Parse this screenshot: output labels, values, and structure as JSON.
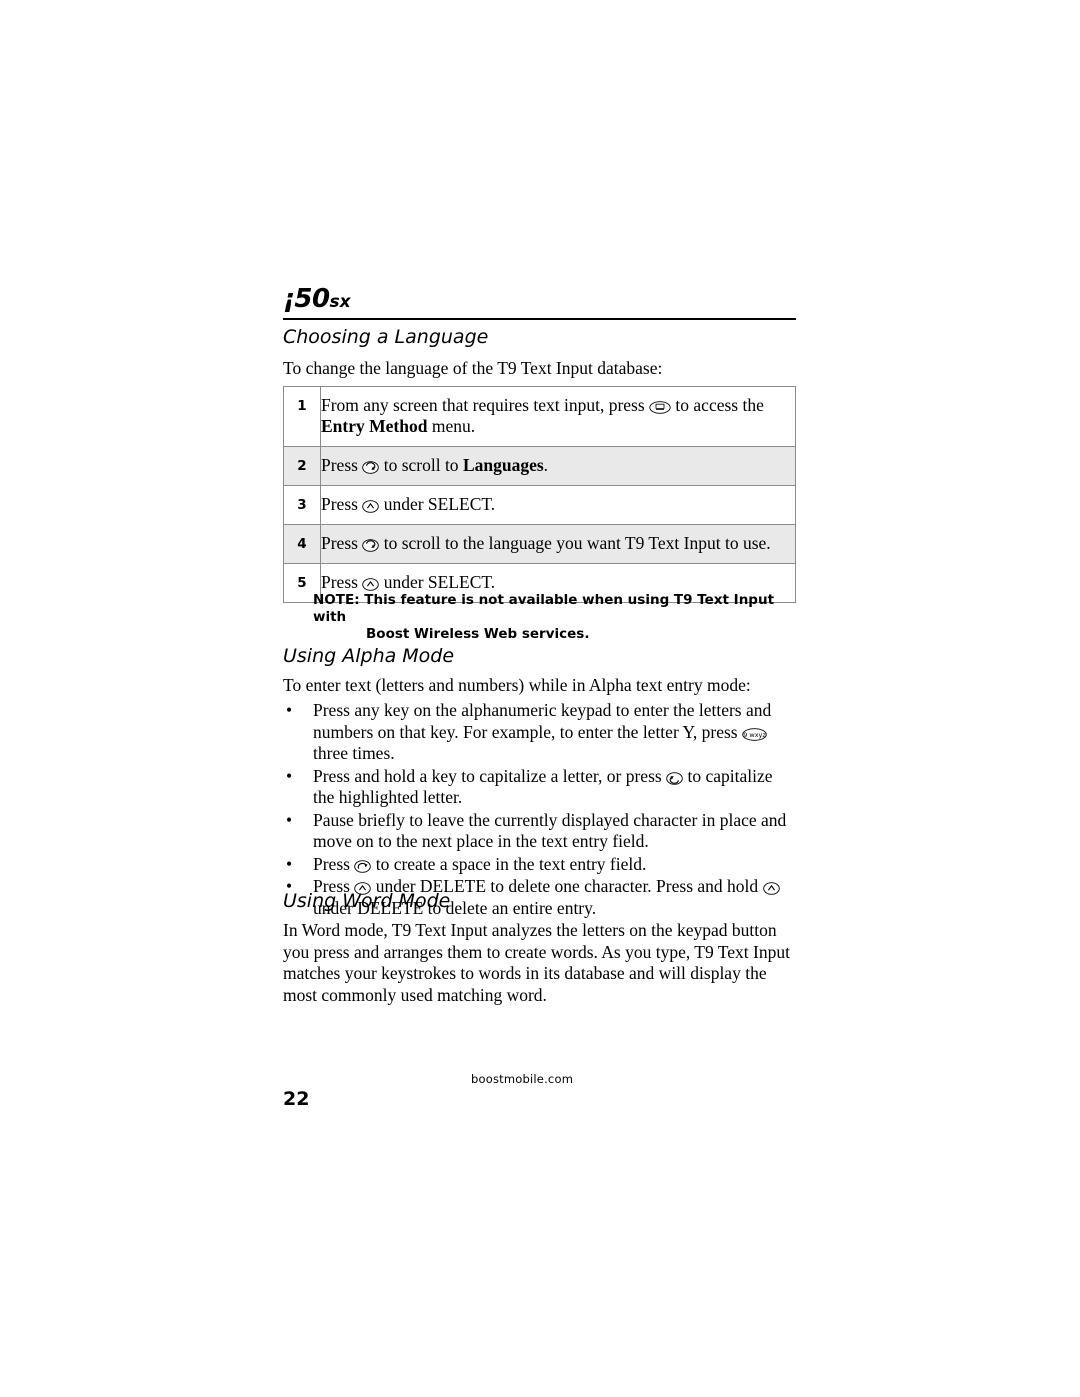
{
  "header": {
    "model": "¡50",
    "model_suffix": "sx"
  },
  "sections": {
    "choosing_language": {
      "heading": "Choosing a Language",
      "intro": "To change the language of the T9 Text Input database:",
      "steps": [
        {
          "num": "1",
          "pre": "From any screen that requires text input, press ",
          "key": "menu-key",
          "mid": " to access the ",
          "bold": "Entry Method",
          "post": " menu."
        },
        {
          "num": "2",
          "pre": "Press ",
          "key": "nav-down-key",
          "mid": " to scroll to ",
          "bold": "Languages",
          "post": "."
        },
        {
          "num": "3",
          "pre": "Press ",
          "key": "softkey-a",
          "mid": " under SELECT.",
          "bold": "",
          "post": ""
        },
        {
          "num": "4",
          "pre": "Press ",
          "key": "nav-down-key",
          "mid": " to scroll to the language you want T9 Text Input to use.",
          "bold": "",
          "post": ""
        },
        {
          "num": "5",
          "pre": "Press ",
          "key": "softkey-a",
          "mid": " under SELECT.",
          "bold": "",
          "post": ""
        }
      ],
      "note_line1": "NOTE: This feature is not available when using T9 Text Input with",
      "note_line2": "Boost Wireless Web services."
    },
    "alpha_mode": {
      "heading": "Using Alpha Mode",
      "intro": "To enter text (letters and numbers) while in Alpha text entry mode:",
      "bullets": [
        {
          "pre": "Press any key on the alphanumeric keypad to enter the letters and numbers on that key. For example, to enter the letter Y, press ",
          "key": "nine-key",
          "post": " three times."
        },
        {
          "pre": "Press and hold a key to capitalize a letter, or press ",
          "key": "nav-up-key",
          "post": " to capitalize the highlighted letter."
        },
        {
          "pre": "Pause briefly to leave the currently displayed character in place and move on to the next place in the text entry field.",
          "key": "",
          "post": ""
        },
        {
          "pre": "Press ",
          "key": "nav-right-key",
          "post": " to create a space in the text entry field."
        },
        {
          "pre": "Press ",
          "key": "softkey-a",
          "post": " under DELETE to delete one character. Press and hold ",
          "key2": "softkey-a",
          "post2": " under DELETE to delete an entire entry."
        }
      ]
    },
    "word_mode": {
      "heading": "Using Word Mode",
      "paragraph": "In Word mode, T9 Text Input analyzes the letters on the keypad button you press and arranges them to create words. As you type, T9 Text Input matches your keystrokes to words in its database and will display the most commonly used matching word."
    }
  },
  "footer": {
    "url": "boostmobile.com",
    "page_number": "22"
  }
}
